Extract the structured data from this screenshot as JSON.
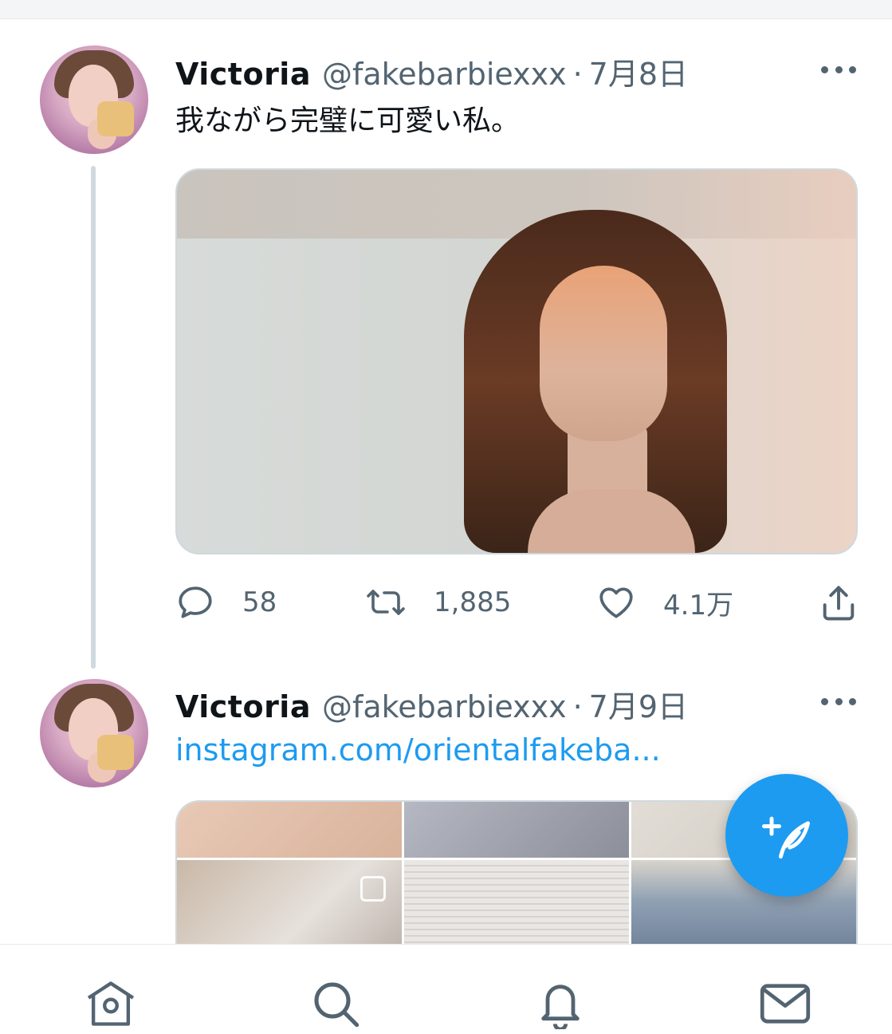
{
  "tweets": [
    {
      "name": "Victoria",
      "handle": "@fakebarbiexxx",
      "separator": "·",
      "date": "7月8日",
      "text": "我ながら完璧に可愛い私。",
      "stats": {
        "replies": "58",
        "retweets": "1,885",
        "likes": "4.1万"
      }
    },
    {
      "name": "Victoria",
      "handle": "@fakebarbiexxx",
      "separator": "·",
      "date": "7月9日",
      "link": "instagram.com/orientalfakeba..."
    }
  ],
  "icons": {
    "reply": "speech-bubble-icon",
    "retweet": "retweet-arrows-icon",
    "like": "heart-icon",
    "share": "share-upload-icon",
    "more": "more-dots-icon",
    "compose": "feather-plus-icon",
    "nav": [
      "home-icon",
      "search-icon",
      "bell-icon",
      "mail-icon"
    ]
  },
  "colors": {
    "accent": "#1d9bf0",
    "text": "#0f1419",
    "muted": "#536471",
    "border": "#cfd9de"
  }
}
